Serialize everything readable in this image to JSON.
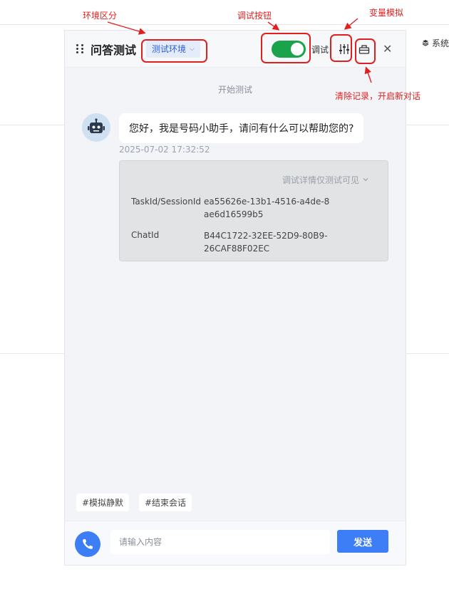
{
  "background": {
    "right_menu_label": "系统"
  },
  "header": {
    "title": "问答测试",
    "env_label": "测试环境",
    "debug_label": "调试",
    "toggle_on": true
  },
  "chat": {
    "start_label": "开始测试",
    "bot_message": "您好，我是号码小助手，请问有什么可以帮助您的?",
    "timestamp": "2025-07-02 17:32:52",
    "debug": {
      "toggle_label": "调试详情仅测试可见",
      "task_key": "TaskId/SessionId",
      "task_value": "ea55626e-13b1-4516-a4de-8ae6d16599b5",
      "chat_key": "ChatId",
      "chat_value": "B44C1722-32EE-52D9-80B9-26CAF88F02EC"
    }
  },
  "quick_actions": [
    "#模拟静默",
    "#结束会话"
  ],
  "footer": {
    "input_placeholder": "请输入内容",
    "send_label": "发送"
  },
  "annotations": {
    "env": "环境区分",
    "debug_button": "调试按钮",
    "variable_mock": "变量模拟",
    "clear_history": "清除记录，开启新对话"
  },
  "colors": {
    "accent": "#3d7ef6",
    "toggle": "#1aa34a",
    "annotation": "#e02020"
  }
}
